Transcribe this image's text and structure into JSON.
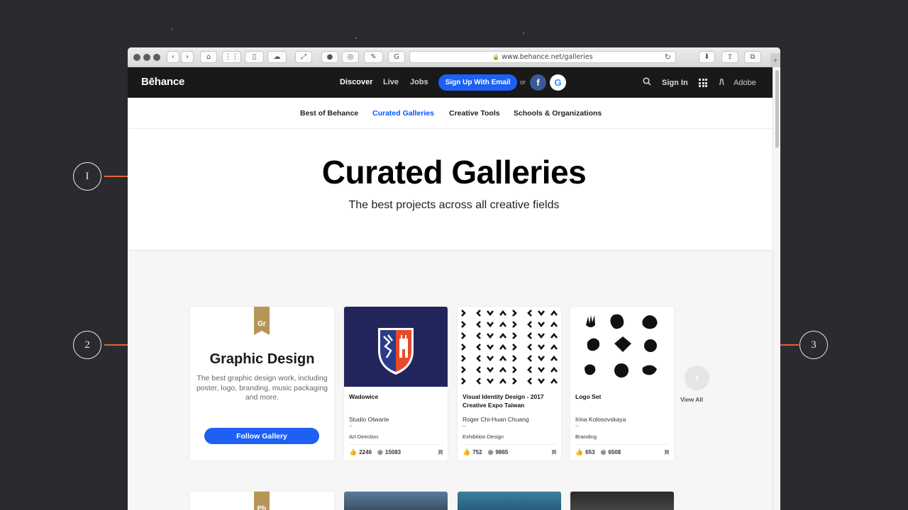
{
  "browser": {
    "url": "www.behance.net/galleries",
    "plus": "+"
  },
  "callouts": [
    "I",
    "2",
    "3"
  ],
  "nav": {
    "logo": "Bēhance",
    "discover": "Discover",
    "live": "Live",
    "jobs": "Jobs",
    "signup": "Sign Up With Email",
    "or": "or",
    "facebook": "f",
    "google": "G",
    "signin": "Sign In",
    "adobe": "Adobe"
  },
  "subnav": {
    "items": [
      "Best of Behance",
      "Curated Galleries",
      "Creative Tools",
      "Schools & Organizations"
    ],
    "active_index": 1
  },
  "hero": {
    "title": "Curated Galleries",
    "subtitle": "The best projects across all creative fields"
  },
  "gallery": {
    "badge": "Gr",
    "title": "Graphic Design",
    "description": "The best graphic design work, including poster, logo, branding, music packaging and more.",
    "follow": "Follow Gallery",
    "view_all": "View All",
    "projects": [
      {
        "title": "Wadowice",
        "owner": "Studio Otwarte",
        "field": "Art Direction",
        "likes": "2246",
        "views": "15083"
      },
      {
        "title": "Visual Identity Design - 2017 Creative Expo Taiwan",
        "owner": "Roger Chi-Huan Chuang",
        "field": "Exhibition Design",
        "likes": "752",
        "views": "9865"
      },
      {
        "title": "Logo Set",
        "owner": "Irina Kolosovskaya",
        "field": "Branding",
        "likes": "653",
        "views": "6508"
      }
    ]
  },
  "next_gallery": {
    "badge": "Ph"
  },
  "colors": {
    "accent": "#1e60f4",
    "active_link": "#0057ff",
    "ribbon": "#b69658",
    "arrow": "#e0643a"
  }
}
